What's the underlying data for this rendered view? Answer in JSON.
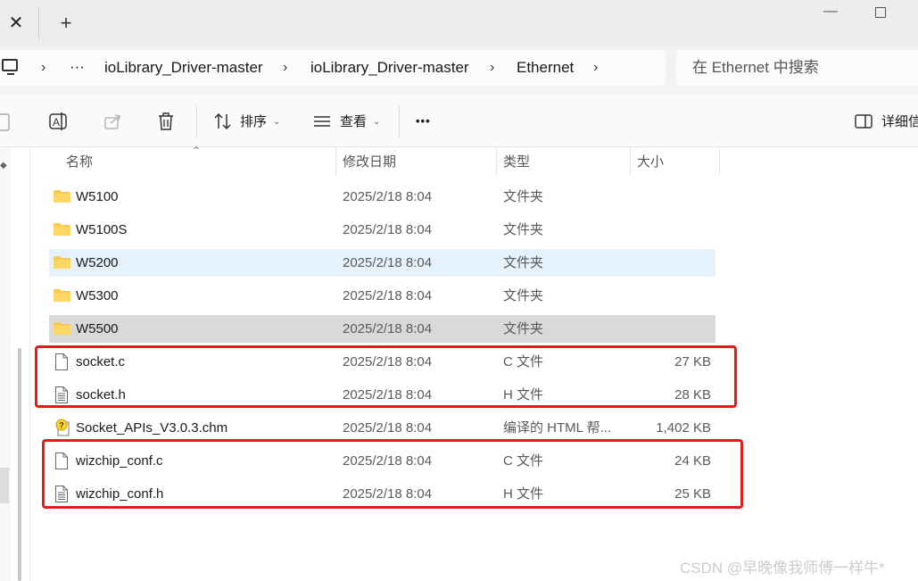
{
  "tabbar": {
    "close_glyph": "✕",
    "new_tab_glyph": "+",
    "minimize_glyph": "—"
  },
  "breadcrumb": {
    "chevron": "›",
    "ellipsis": "···",
    "items": [
      "ioLibrary_Driver-master",
      "ioLibrary_Driver-master",
      "Ethernet"
    ]
  },
  "search": {
    "placeholder": "在 Ethernet 中搜索"
  },
  "toolbar": {
    "sort_label": "排序",
    "view_label": "查看",
    "more_label": "•••",
    "details_label": "详细信"
  },
  "columns": {
    "name": "名称",
    "date": "修改日期",
    "type": "类型",
    "size": "大小"
  },
  "files": [
    {
      "name": "W5100",
      "date": "2025/2/18 8:04",
      "type": "文件夹",
      "size": "",
      "kind": "folder",
      "state": ""
    },
    {
      "name": "W5100S",
      "date": "2025/2/18 8:04",
      "type": "文件夹",
      "size": "",
      "kind": "folder",
      "state": ""
    },
    {
      "name": "W5200",
      "date": "2025/2/18 8:04",
      "type": "文件夹",
      "size": "",
      "kind": "folder",
      "state": "hover"
    },
    {
      "name": "W5300",
      "date": "2025/2/18 8:04",
      "type": "文件夹",
      "size": "",
      "kind": "folder",
      "state": ""
    },
    {
      "name": "W5500",
      "date": "2025/2/18 8:04",
      "type": "文件夹",
      "size": "",
      "kind": "folder",
      "state": "selected"
    },
    {
      "name": "socket.c",
      "date": "2025/2/18 8:04",
      "type": "C 文件",
      "size": "27 KB",
      "kind": "c-file",
      "state": ""
    },
    {
      "name": "socket.h",
      "date": "2025/2/18 8:04",
      "type": "H 文件",
      "size": "28 KB",
      "kind": "h-file",
      "state": ""
    },
    {
      "name": "Socket_APIs_V3.0.3.chm",
      "date": "2025/2/18 8:04",
      "type": "编译的 HTML 帮...",
      "size": "1,402 KB",
      "kind": "chm-file",
      "state": ""
    },
    {
      "name": "wizchip_conf.c",
      "date": "2025/2/18 8:04",
      "type": "C 文件",
      "size": "24 KB",
      "kind": "c-file",
      "state": ""
    },
    {
      "name": "wizchip_conf.h",
      "date": "2025/2/18 8:04",
      "type": "H 文件",
      "size": "25 KB",
      "kind": "h-file",
      "state": ""
    }
  ],
  "colors": {
    "highlight_box": "#e31b1b",
    "hover_row": "#e5f1fb",
    "selected_row": "#d9d9d9",
    "folder": "#f8c94a"
  },
  "watermark": "CSDN @早晚像我师傅一样牛*"
}
